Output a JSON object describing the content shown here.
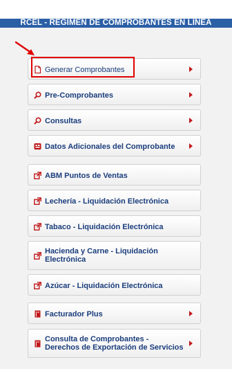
{
  "header": {
    "title": "RCEL - RÉGIMEN DE COMPROBANTES EN LÍNEA"
  },
  "colors": {
    "header_bg": "#2b5fa6",
    "label": "#1a3d7c",
    "accent": "#c0181a",
    "highlight": "#e00000"
  },
  "menu": {
    "items": [
      {
        "label": "Generar Comprobantes",
        "icon": "document-icon",
        "submenu": true
      },
      {
        "label": "Pre-Comprobantes",
        "icon": "search-icon",
        "submenu": true
      },
      {
        "label": "Consultas",
        "icon": "search-icon",
        "submenu": true
      },
      {
        "label": "Datos Adicionales del Comprobante",
        "icon": "data-icon",
        "submenu": true
      },
      {
        "label": "ABM Puntos de Ventas",
        "icon": "link-icon",
        "submenu": false
      },
      {
        "label": "Lechería - Liquidación Electrónica",
        "icon": "link-icon",
        "submenu": false
      },
      {
        "label": "Tabaco - Liquidación Electrónica",
        "icon": "link-icon",
        "submenu": false
      },
      {
        "label": "Hacienda y Carne - Liquidación Electrónica",
        "icon": "link-icon",
        "submenu": false
      },
      {
        "label": "Azúcar - Liquidación Electrónica",
        "icon": "link-icon",
        "submenu": false
      },
      {
        "label": "Facturador Plus",
        "icon": "book-icon",
        "submenu": true
      },
      {
        "label": "Consulta de Comprobantes - Derechos de Exportación de Servicios",
        "icon": "book-icon",
        "submenu": true
      }
    ]
  }
}
